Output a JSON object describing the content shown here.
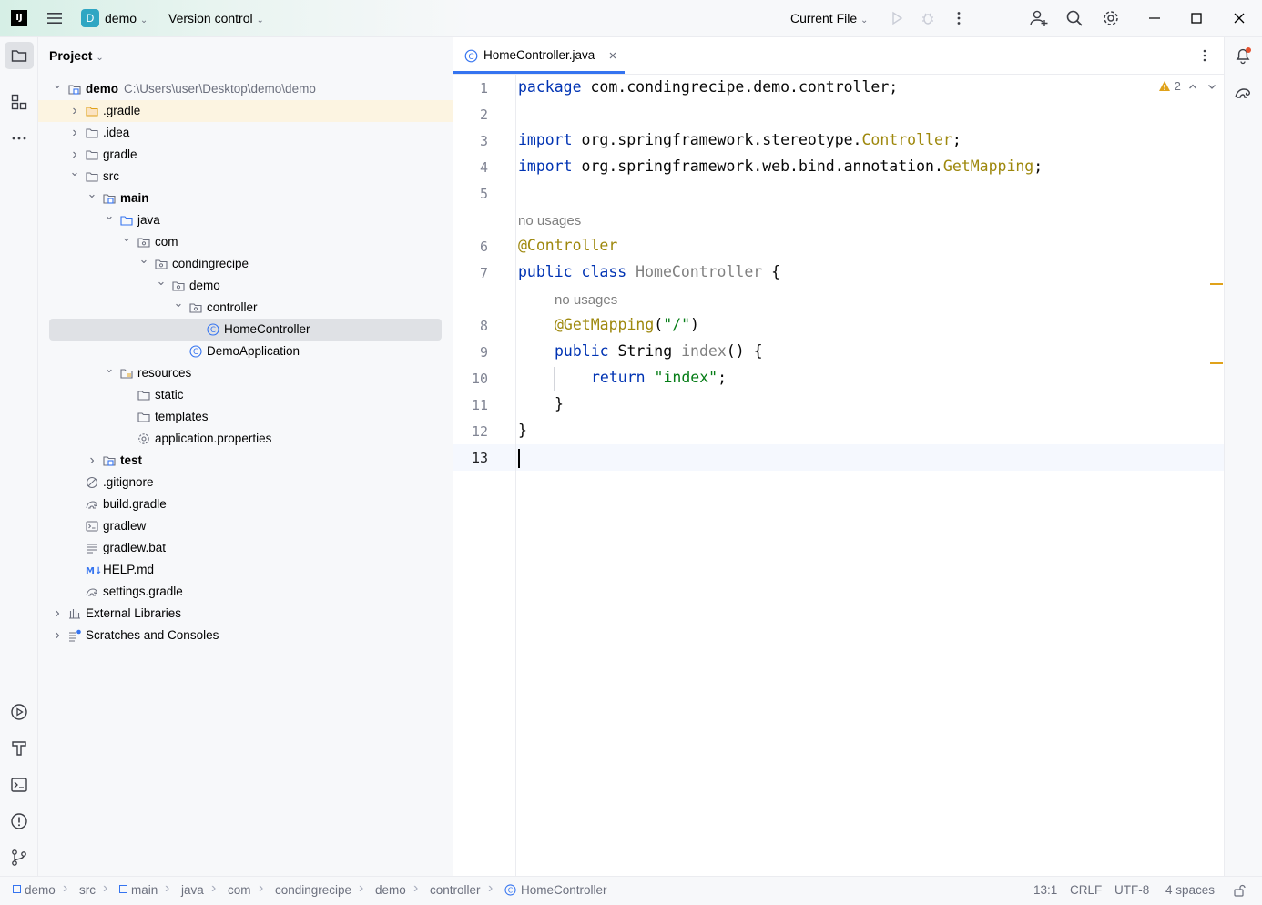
{
  "titlebar": {
    "logo": "IJ",
    "project_badge": "D",
    "project_name": "demo",
    "vcs_label": "Version control",
    "run_config": "Current File",
    "colors": {
      "badge_bg": "#2fa6c3",
      "accent": "#3574f0"
    }
  },
  "project_panel": {
    "title": "Project",
    "tree": [
      {
        "label": "demo",
        "path": "C:\\Users\\user\\Desktop\\demo\\demo",
        "bold": true,
        "icon": "module-folder-icon",
        "expanded": true
      },
      {
        "label": ".gradle",
        "icon": "folder-excluded-icon",
        "expanded": false
      },
      {
        "label": ".idea",
        "icon": "folder-icon",
        "expanded": false
      },
      {
        "label": "gradle",
        "icon": "folder-icon",
        "expanded": false
      },
      {
        "label": "src",
        "icon": "folder-icon",
        "expanded": true
      },
      {
        "label": "main",
        "bold": true,
        "icon": "module-folder-icon",
        "expanded": true
      },
      {
        "label": "java",
        "icon": "source-folder-icon",
        "expanded": true
      },
      {
        "label": "com",
        "icon": "package-icon",
        "expanded": true
      },
      {
        "label": "condingrecipe",
        "icon": "package-icon",
        "expanded": true
      },
      {
        "label": "demo",
        "icon": "package-icon",
        "expanded": true
      },
      {
        "label": "controller",
        "icon": "package-icon",
        "expanded": true
      },
      {
        "label": "HomeController",
        "icon": "java-class-icon"
      },
      {
        "label": "DemoApplication",
        "icon": "java-class-icon"
      },
      {
        "label": "resources",
        "icon": "resources-folder-icon",
        "expanded": true
      },
      {
        "label": "static",
        "icon": "folder-icon"
      },
      {
        "label": "templates",
        "icon": "folder-icon"
      },
      {
        "label": "application.properties",
        "icon": "gear-file-icon"
      },
      {
        "label": "test",
        "bold": true,
        "icon": "module-folder-icon",
        "expanded": false
      },
      {
        "label": ".gitignore",
        "icon": "ignore-file-icon"
      },
      {
        "label": "build.gradle",
        "icon": "gradle-icon"
      },
      {
        "label": "gradlew",
        "icon": "terminal-file-icon"
      },
      {
        "label": "gradlew.bat",
        "icon": "text-file-icon"
      },
      {
        "label": "HELP.md",
        "icon": "markdown-icon"
      },
      {
        "label": "settings.gradle",
        "icon": "gradle-icon"
      },
      {
        "label": "External Libraries",
        "icon": "library-icon",
        "expanded": false
      },
      {
        "label": "Scratches and Consoles",
        "icon": "scratches-icon",
        "expanded": false
      }
    ]
  },
  "editor": {
    "tab_label": "HomeController.java",
    "warning_count": "2",
    "hint_no_usages": "no usages",
    "line_numbers": [
      "1",
      "2",
      "3",
      "4",
      "5",
      "6",
      "7",
      "8",
      "9",
      "10",
      "11",
      "12",
      "13"
    ],
    "code": {
      "l1_kw": "package",
      "l1_rest": " com.condingrecipe.demo.controller;",
      "l3_kw": "import",
      "l3_pkg": " org.springframework.stereotype.",
      "l3_cls": "Controller",
      "l3_end": ";",
      "l4_kw": "import",
      "l4_pkg": " org.springframework.web.bind.annotation.",
      "l4_cls": "GetMapping",
      "l4_end": ";",
      "l6_ann": "@Controller",
      "l7_kw": "public class",
      "l7_cls": " HomeController",
      "l7_end": " {",
      "l8_ann": "@GetMapping",
      "l8_open": "(",
      "l8_str": "\"/\"",
      "l8_close": ")",
      "l9_kw": "public",
      "l9_type": " String ",
      "l9_fn": "index",
      "l9_end": "() {",
      "l10_kw": "return",
      "l10_sp": " ",
      "l10_str": "\"index\"",
      "l10_end": ";",
      "l11": "}",
      "l12": "}"
    }
  },
  "statusbar": {
    "breadcrumbs": [
      "demo",
      "src",
      "main",
      "java",
      "com",
      "condingrecipe",
      "demo",
      "controller",
      "HomeController"
    ],
    "position": "13:1",
    "line_sep": "CRLF",
    "encoding": "UTF-8",
    "indent": "4 spaces"
  }
}
